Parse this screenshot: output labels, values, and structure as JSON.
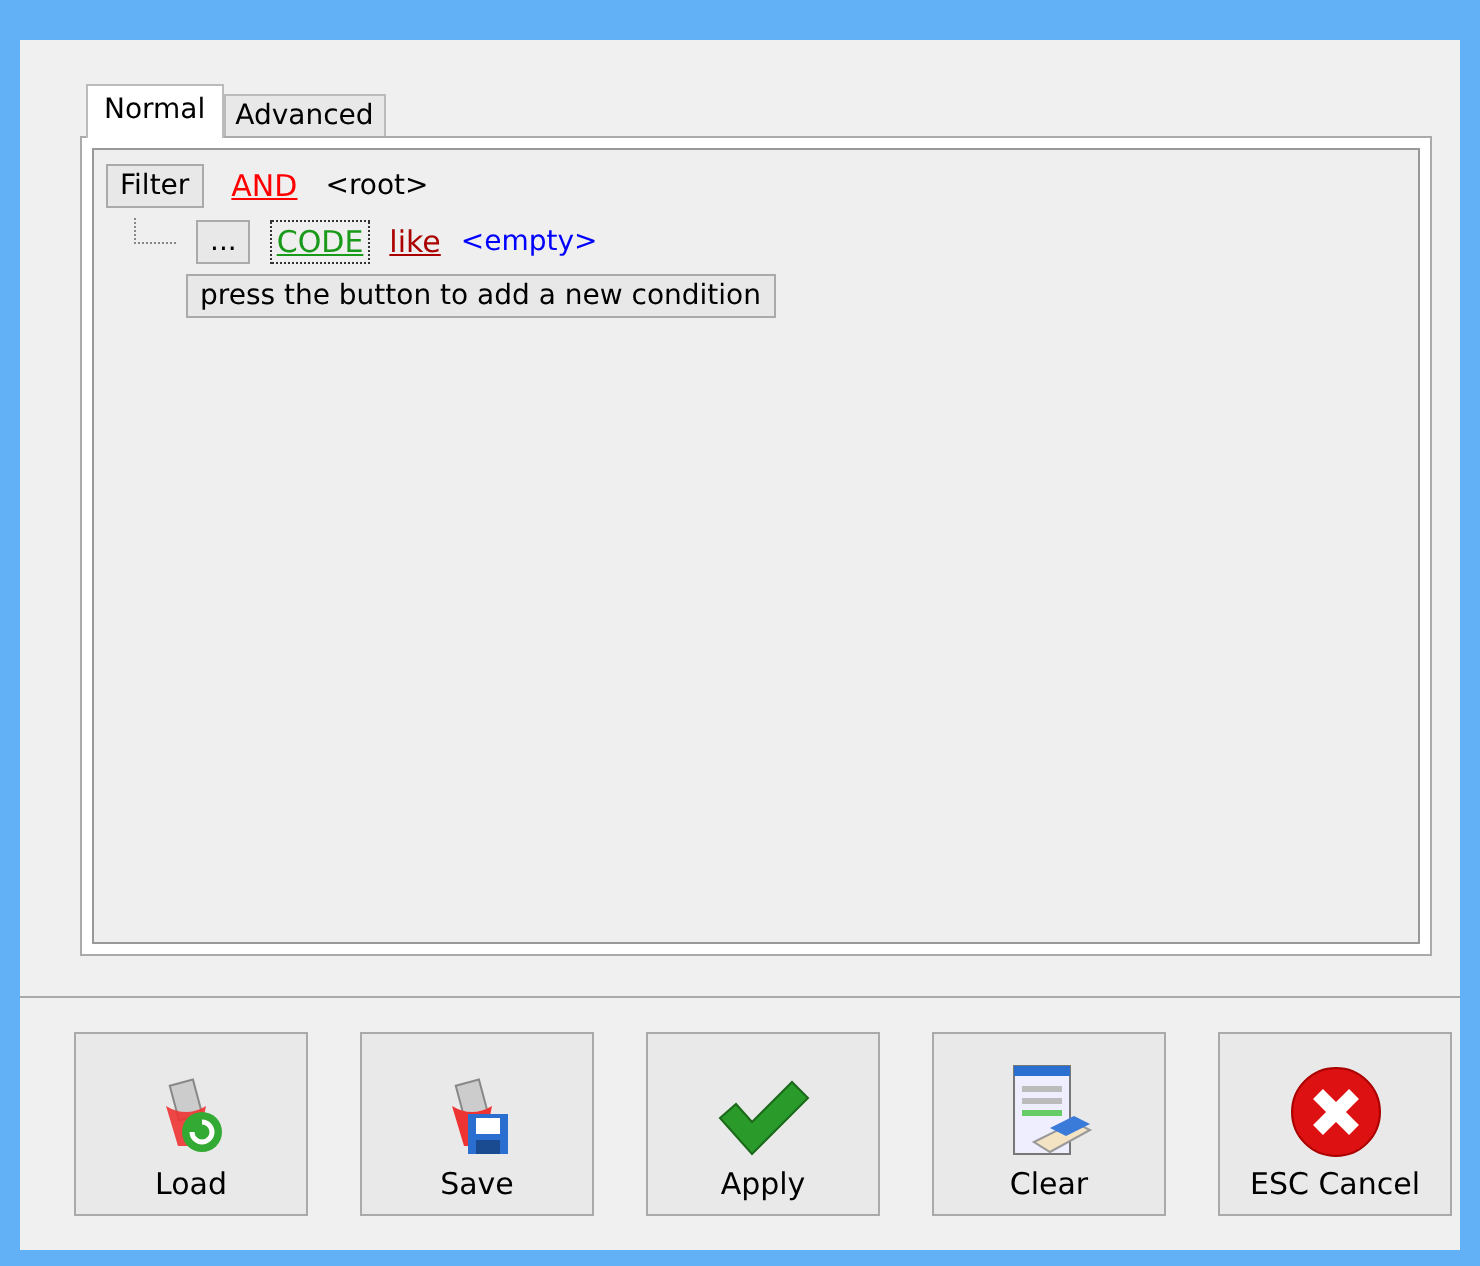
{
  "tabs": [
    {
      "label": "Normal",
      "selected": true
    },
    {
      "label": "Advanced",
      "selected": false
    }
  ],
  "filter": {
    "root_button": "Filter",
    "operator": "AND",
    "root_label": "<root>",
    "conditions": [
      {
        "menu_button": "...",
        "field": "CODE",
        "comparison": "like",
        "value": "<empty>",
        "focused": true
      }
    ],
    "add_hint": "press the button to add a new condition"
  },
  "buttons": [
    {
      "label": "Load",
      "kind": "load"
    },
    {
      "label": "Save",
      "kind": "save"
    },
    {
      "label": "Apply",
      "kind": "apply"
    },
    {
      "label": "Clear",
      "kind": "clear"
    },
    {
      "label": "ESC Cancel",
      "kind": "cancel"
    }
  ]
}
